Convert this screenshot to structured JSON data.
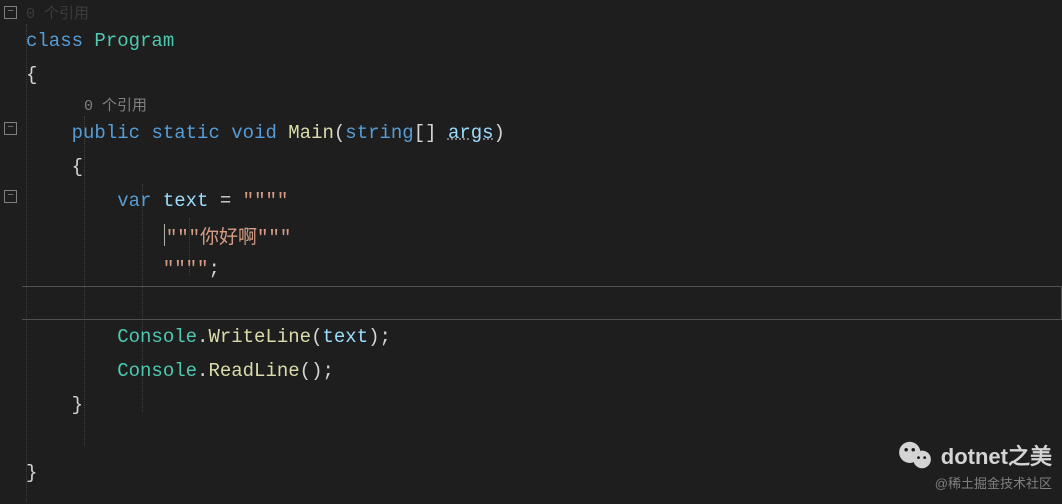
{
  "codelens": {
    "ref0_top": "0 个引用",
    "ref0_main": "0 个引用"
  },
  "code": {
    "class_kw": "class",
    "class_name": "Program",
    "open_brace": "{",
    "close_brace": "}",
    "public_kw": "public",
    "static_kw": "static",
    "void_kw": "void",
    "main_name": "Main",
    "string_type": "string",
    "brackets": "[]",
    "args": "args",
    "var_kw": "var",
    "text_var": "text",
    "equals": " = ",
    "raw_open": "\"\"\"\"",
    "raw_content": "\"\"\"你好啊\"\"\"",
    "raw_close": "\"\"\"\"",
    "semicolon": ";",
    "console": "Console",
    "dot": ".",
    "writeline": "WriteLine",
    "readline": "ReadLine",
    "lparen": "(",
    "rparen": ")",
    "text_ref": "text"
  },
  "watermark": {
    "title": "dotnet之美",
    "subtitle": "@稀土掘金技术社区"
  }
}
